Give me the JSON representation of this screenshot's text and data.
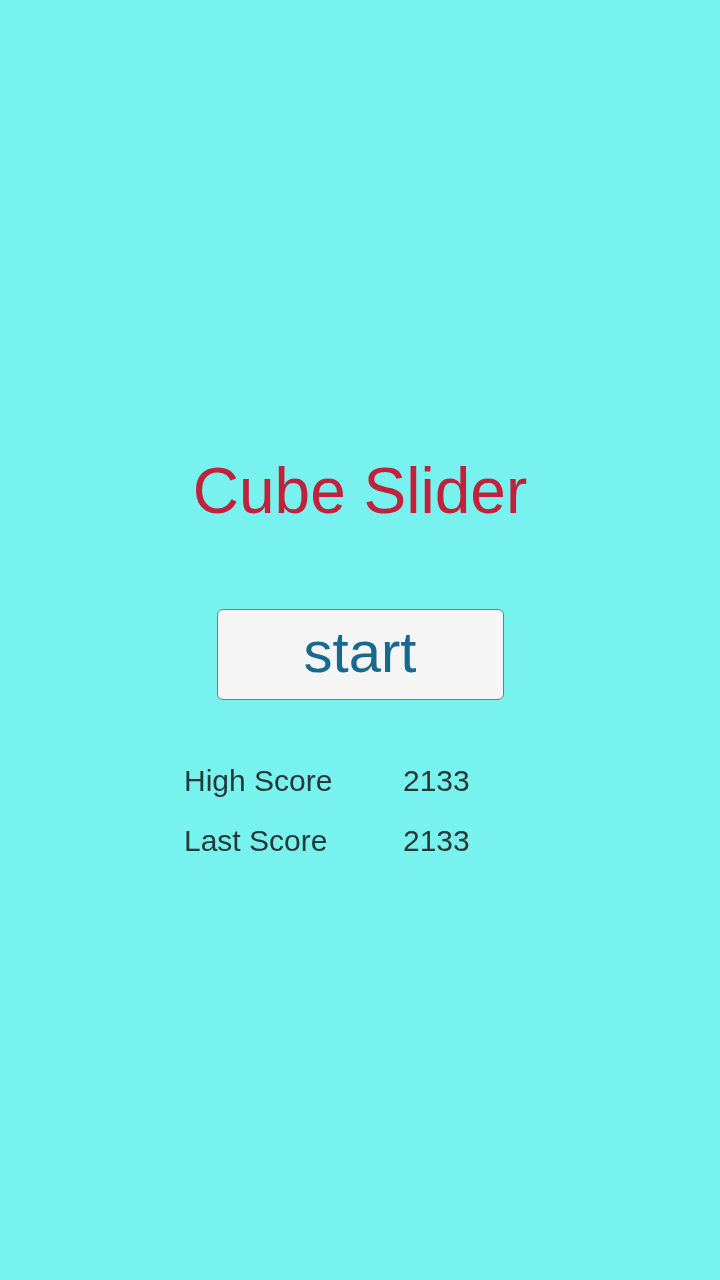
{
  "title": "Cube Slider",
  "start_button": {
    "label": "start"
  },
  "scores": [
    {
      "label": "High Score",
      "value": "2133"
    },
    {
      "label": "Last Score",
      "value": "2133"
    }
  ]
}
